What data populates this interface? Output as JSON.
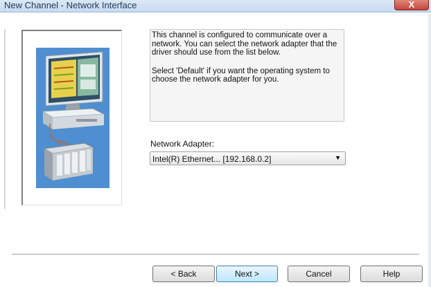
{
  "window": {
    "title": "New Channel - Network Interface",
    "close_label": "X"
  },
  "description": {
    "paragraph1": "This channel is configured to communicate over a network.  You can select the network adapter that the driver should use from the list below.",
    "paragraph2": "Select 'Default' if you want the operating system to choose the network adapter for you."
  },
  "network_adapter": {
    "label": "Network Adapter:",
    "selected_value": "Intel(R) Ethernet... [192.168.0.2]"
  },
  "buttons": {
    "back": "< Back",
    "next": "Next >",
    "cancel": "Cancel",
    "help": "Help"
  },
  "colors": {
    "illustration_bg": "#4f8ed0",
    "title_text": "#1e395b",
    "close_button": "#c7453a"
  },
  "icons": {
    "illustration": "computer-network-plc-illustration",
    "dropdown": "chevron-down-icon"
  }
}
